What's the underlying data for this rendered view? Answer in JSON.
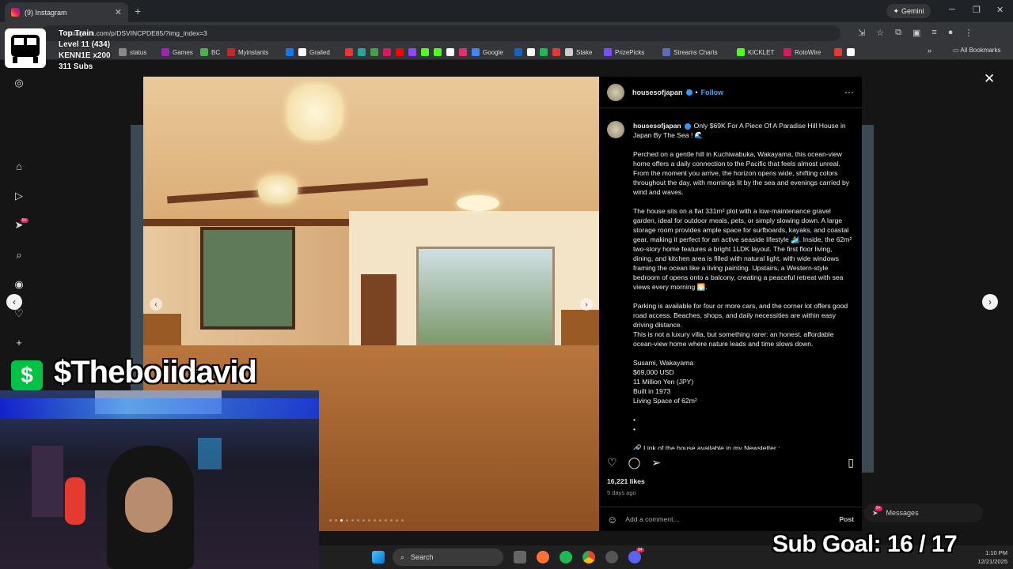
{
  "browser": {
    "tab_title": "(9) Instagram",
    "url": "instagram.com/p/DSVINCPDE85/?img_index=3",
    "gemini_label": "Gemini",
    "all_bookmarks": "All Bookmarks",
    "bookmarks": [
      {
        "label": "status",
        "color": "#888888"
      },
      {
        "label": "Games",
        "color": "#9c27b0"
      },
      {
        "label": "BC",
        "color": "#4caf50"
      },
      {
        "label": "Myinstants",
        "color": "#c62828"
      },
      {
        "label": "",
        "color": "#1877f2"
      },
      {
        "label": "Grailed",
        "color": "#ffffff"
      },
      {
        "label": "",
        "color": "#e53935"
      },
      {
        "label": "",
        "color": "#26a69a"
      },
      {
        "label": "",
        "color": "#43a047"
      },
      {
        "label": "",
        "color": "#d81b60"
      },
      {
        "label": "",
        "color": "#ff0000"
      },
      {
        "label": "",
        "color": "#9146ff"
      },
      {
        "label": "",
        "color": "#53fc18"
      },
      {
        "label": "",
        "color": "#53fc18"
      },
      {
        "label": "",
        "color": "#ffffff"
      },
      {
        "label": "",
        "color": "#e1306c"
      },
      {
        "label": "Google",
        "color": "#4285f4"
      },
      {
        "label": "",
        "color": "#1565c0"
      },
      {
        "label": "",
        "color": "#ffffff"
      },
      {
        "label": "",
        "color": "#1db954"
      },
      {
        "label": "",
        "color": "#e53935"
      },
      {
        "label": "Stake",
        "color": "#cccccc"
      },
      {
        "label": "PrizePicks",
        "color": "#7c4dff"
      },
      {
        "label": "Streams Charts",
        "color": "#5c6bc0"
      },
      {
        "label": "KICKLET",
        "color": "#53fc18"
      },
      {
        "label": "RotoWire",
        "color": "#d81b60"
      },
      {
        "label": "",
        "color": "#e53935"
      },
      {
        "label": "",
        "color": "#ffffff"
      }
    ]
  },
  "post": {
    "username": "housesofjapan",
    "follow_label": "Follow",
    "caption_headline": "Only $69K For A Piece Of A Paradise Hill House in Japan By The Sea ! 🌊",
    "paragraphs": [
      "Perched on a gentle hill in Kuchiwabuka, Wakayama, this ocean-view home offers a daily connection to the Pacific that feels almost unreal. From the moment you arrive, the horizon opens wide, shifting colors throughout the day, with mornings lit by the sea and evenings carried by wind and waves.",
      "The house sits on a flat 331m² plot with a low-maintenance gravel garden, ideal for outdoor meals, pets, or simply slowing down. A large storage room provides ample space for surfboards, kayaks, and coastal gear, making it perfect for an active seaside lifestyle 🏄. Inside, the 62m² two-story home features a bright 1LDK layout. The first floor living, dining, and kitchen area is filled with natural light, with wide windows framing the ocean like a living painting. Upstairs, a Western-style bedroom of opens onto a balcony, creating a peaceful retreat with sea views every morning 🌅.",
      "Parking is available for four or more cars, and the corner lot offers good road access. Beaches, shops, and daily necessities are within easy driving distance.\nThis is not a luxury villa, but something rarer: an honest, affordable ocean-view home where nature leads and time slows down.",
      "Susami, Wakayama\n$69,000 USD\n11 Million Yen (JPY)\nBuilt in 1973\nLiving Space of 62m²",
      "•\n•",
      "🔗 Link of the house available in my Newsletter :"
    ],
    "likes": "16,221 likes",
    "time_ago": "5 days ago",
    "comment_placeholder": "Add a comment...",
    "post_label": "Post",
    "carousel_count": 14,
    "carousel_active": 3
  },
  "messages": {
    "label": "Messages",
    "badge": "9+"
  },
  "rail_badge": "9+",
  "stream": {
    "train_title": "Top Train",
    "train_level": "Level 11  (434)",
    "train_user": "KENN1E x200",
    "train_subs": "311 Subs",
    "cashtag": "$Theboiidavid",
    "sub_goal": "Sub Goal:  16 / 17"
  },
  "taskbar": {
    "search_label": "Search",
    "time": "1:10 PM",
    "date": "12/21/2025",
    "discord_badge": "94"
  }
}
